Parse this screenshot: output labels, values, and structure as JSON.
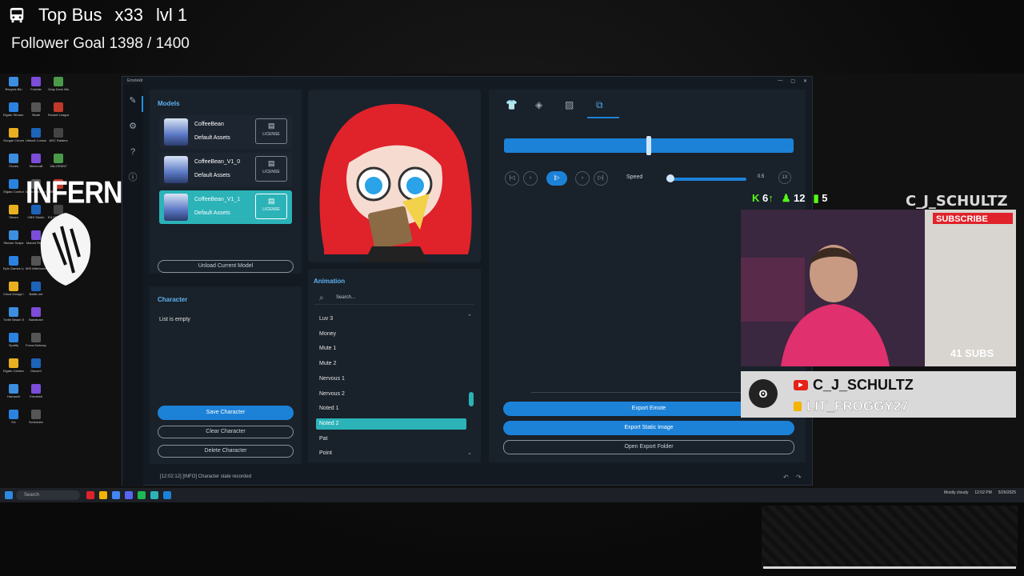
{
  "overlay": {
    "bus_label": "Top Bus",
    "bus_multiplier": "x33",
    "bus_level": "lvl 1",
    "follower_goal": "Follower Goal 1398 / 1400",
    "inferno": "INFERNO"
  },
  "desktop_icons": [
    "Recycle Bin",
    "Fortnite",
    "Gray Zone Warfare",
    "Elgato Stream Deck",
    "Skate",
    "Rocket League",
    "Google Chrome",
    "Ubisoft Connect",
    "ARC Raiders",
    "iTunes",
    "Minecraft",
    "VALORANT",
    "Elgato Control",
    "Meta Horizon Link",
    "BNW Strats",
    "Steam",
    "OBS Studio",
    "EA SPORTS Madden",
    "Stream Scape",
    "Marvel Rivals",
    "House Flipper 2",
    "Epic Games Launcher",
    "MSI Afterburner",
    "Crosshair",
    "Cricut Design Space",
    "Battle.net",
    "",
    "Turtle Beach Swarm II",
    "Bandicam",
    "",
    "Spotify",
    "Forza Motorsport",
    "",
    "Elgato Camera Hub",
    "Discord",
    "",
    "Hamachi",
    "Emotekit",
    "",
    "EA",
    "Scheduler",
    ""
  ],
  "window": {
    "title": "Emotekit",
    "models_title": "Models",
    "models": [
      {
        "name": "CoffeeBean",
        "sub": "Default Assets",
        "license": "LICENSE",
        "selected": false
      },
      {
        "name": "CoffeeBean_V1_0",
        "sub": "Default Assets",
        "license": "LICENSE",
        "selected": false
      },
      {
        "name": "CoffeeBean_V1_1",
        "sub": "Default Assets",
        "license": "LICENSE",
        "selected": true
      }
    ],
    "unload": "Unload Current Model",
    "character_title": "Character",
    "character_empty": "List is empty",
    "save_character": "Save Character",
    "clear_character": "Clear Character",
    "delete_character": "Delete Character",
    "animation_title": "Animation",
    "search_placeholder": "Search...",
    "animations": [
      "Luv 3",
      "Money",
      "Mute 1",
      "Mute 2",
      "Nervous 1",
      "Nervous 2",
      "Noted 1",
      "Noted 2",
      "Pat",
      "Point"
    ],
    "selected_animation": "Noted 2",
    "speed_label": "Speed",
    "speed_value": "0.5",
    "speed_reset": "1X",
    "speed_fraction": 0.05,
    "timeline_position": 0.5,
    "export_emote": "Export Emote",
    "export_static": "Export Static Image",
    "open_export": "Open Export Folder",
    "status": "[12:02:12] [INFO] Character state recorded",
    "accent": "#1c82d8",
    "selected_color": "#2bb3b8"
  },
  "taskbar": {
    "search": "Search",
    "tray_weather": "Mostly cloudy",
    "time": "12:02 PM",
    "date": "5/26/2025"
  },
  "stream": {
    "kick_count": "6",
    "viewers": "12",
    "bars_count": "5",
    "channel": "C_J_SCHULTZ",
    "subs": "41 SUBS",
    "yt_name": "C_J_SCHULTZ",
    "sub_name": "LIT_FROGGY27",
    "subscribe": "SUBSCRIBE"
  }
}
